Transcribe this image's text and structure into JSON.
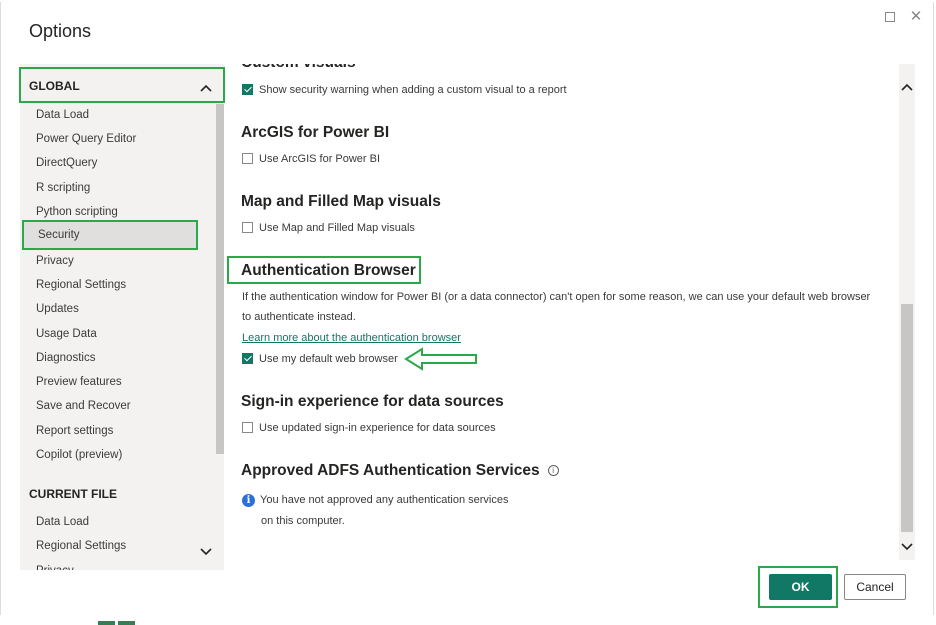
{
  "dialog": {
    "title": "Options",
    "ok_label": "OK",
    "cancel_label": "Cancel"
  },
  "sidebar": {
    "global_label": "GLOBAL",
    "current_file_label": "CURRENT FILE",
    "global_items": [
      {
        "label": "Data Load"
      },
      {
        "label": "Power Query Editor"
      },
      {
        "label": "DirectQuery"
      },
      {
        "label": "R scripting"
      },
      {
        "label": "Python scripting"
      },
      {
        "label": "Security"
      },
      {
        "label": "Privacy"
      },
      {
        "label": "Regional Settings"
      },
      {
        "label": "Updates"
      },
      {
        "label": "Usage Data"
      },
      {
        "label": "Diagnostics"
      },
      {
        "label": "Preview features"
      },
      {
        "label": "Save and Recover"
      },
      {
        "label": "Report settings"
      },
      {
        "label": "Copilot (preview)"
      }
    ],
    "file_items": [
      {
        "label": "Data Load"
      },
      {
        "label": "Regional Settings"
      },
      {
        "label": "Privacy"
      }
    ],
    "selected": "Security"
  },
  "content": {
    "custom_visuals": {
      "title": "Custom visuals",
      "checkbox_label": "Show security warning when adding a custom visual to a report",
      "checked": true
    },
    "arcgis": {
      "title": "ArcGIS for Power BI",
      "checkbox_label": "Use ArcGIS for Power BI",
      "checked": false
    },
    "map": {
      "title": "Map and Filled Map visuals",
      "checkbox_label": "Use Map and Filled Map visuals",
      "checked": false
    },
    "auth_browser": {
      "title": "Authentication Browser",
      "description_line1": "If the authentication window for Power BI (or a data connector) can't open for some reason, we can use your default web browser",
      "description_line2": "to authenticate instead.",
      "link": "Learn more about the authentication browser",
      "checkbox_label": "Use my default web browser",
      "checked": true
    },
    "signin": {
      "title": "Sign-in experience for data sources",
      "checkbox_label": "Use updated sign-in experience for data sources",
      "checked": false
    },
    "adfs": {
      "title": "Approved ADFS Authentication Services",
      "info_line1": "You have not approved any authentication services",
      "info_line2": "on this computer."
    }
  },
  "colors": {
    "accent": "#117865",
    "highlight": "#2aa84a",
    "info": "#2a6fdb"
  }
}
